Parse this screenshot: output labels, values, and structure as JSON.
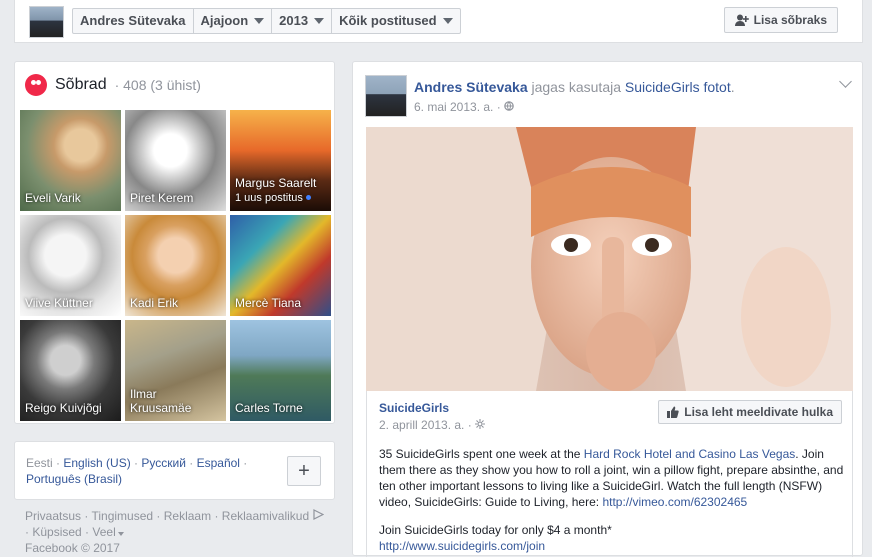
{
  "topbar": {
    "crumbs": [
      "Andres Sütevaka",
      "Ajajoon",
      "2013",
      "Kõik postitused"
    ],
    "add_friend": "Lisa sõbraks"
  },
  "friends": {
    "title": "Sõbrad",
    "count": "· 408 (3 ühist)",
    "items": [
      {
        "name": "Eveli Varik",
        "sub": ""
      },
      {
        "name": "Piret Kerem",
        "sub": ""
      },
      {
        "name": "Margus Saarelt",
        "sub": "1 uus postitus"
      },
      {
        "name": "Viive Küttner",
        "sub": ""
      },
      {
        "name": "Kadi Erik",
        "sub": ""
      },
      {
        "name": "Mercè Tiana",
        "sub": ""
      },
      {
        "name": "Reigo Kuivjõgi",
        "sub": ""
      },
      {
        "name": "Ilmar Kruusamäe",
        "sub": ""
      },
      {
        "name": "Carles Torne",
        "sub": ""
      }
    ]
  },
  "languages": {
    "current": "Eesti",
    "others": [
      "English (US)",
      "Русский",
      "Español",
      "Português (Brasil)"
    ],
    "plus": "+"
  },
  "footer": [
    "Privaatsus",
    "Tingimused",
    "Reklaam",
    "Reklaamivalikud",
    "Küpsised",
    "Veel",
    "Facebook © 2017"
  ],
  "post": {
    "author": "Andres Sütevaka",
    "action": "jagas kasutaja",
    "target": "SuicideGirls fotot",
    "date": "6. mai 2013. a.",
    "shared_page": "SuicideGirls",
    "shared_date": "2. aprill 2013. a.",
    "like_button": "Lisa leht meeldivate hulka",
    "text_1": "35 SuicideGirls spent one week at the ",
    "text_link": "Hard Rock Hotel and Casino Las Vegas",
    "text_2": ". Join them there as they show you how to roll a joint, win a pillow fight, prepare absinthe, and ten other important lessons to living like a SuicideGirl. Watch the full length (NSFW) video, SuicideGirls: Guide to Living, here: ",
    "video_link": "http://vimeo.com/62302465",
    "text_3": "Join SuicideGirls today for only $4 a month*",
    "site_link": "http://www.suicidegirls.com/join"
  }
}
